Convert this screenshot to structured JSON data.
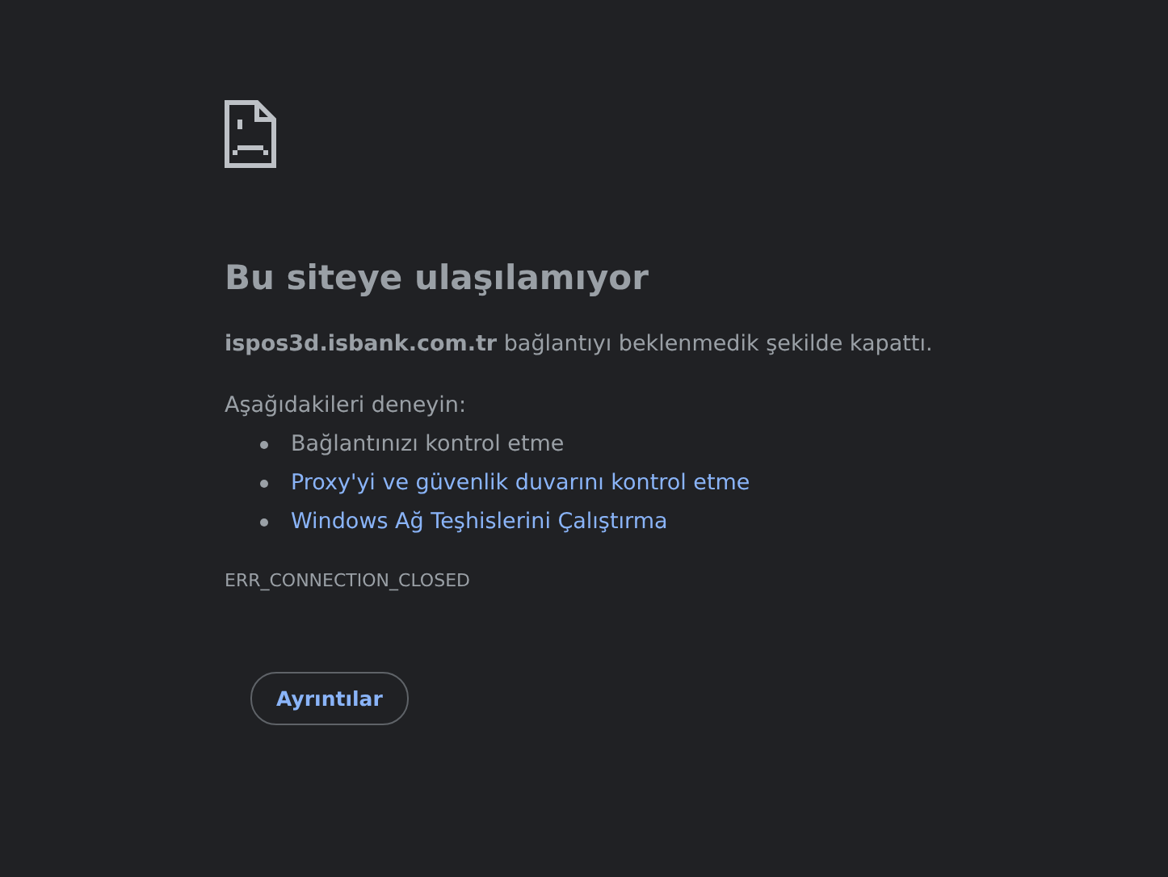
{
  "heading": "Bu siteye ulaşılamıyor",
  "message": "**ispos3d.isbank.com.tr** bağlantıyı beklenmedik şekilde kapattı.",
  "suggestions_title": "Aşağıdakileri deneyin:",
  "suggestions": [
    {
      "kind": "text",
      "label": "Bağlantınızı kontrol etme"
    },
    {
      "kind": "link",
      "label": "Proxy'yi ve güvenlik duvarını kontrol etme"
    },
    {
      "kind": "link",
      "label": "Windows Ağ Teşhislerini Çalıştırma"
    }
  ],
  "error_code": "ERR_CONNECTION_CLOSED",
  "details_button": "Ayrıntılar"
}
